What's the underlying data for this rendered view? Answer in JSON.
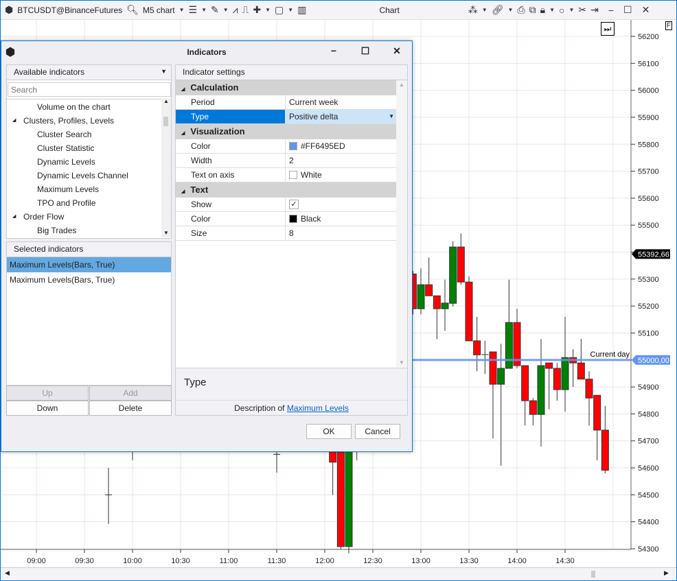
{
  "toolbar": {
    "symbol": "BTCUSDT@BinanceFutures",
    "timeframe": "M5 chart",
    "title": "Chart"
  },
  "dialog": {
    "title": "Indicators",
    "available_label": "Available indicators",
    "search_placeholder": "Search",
    "tree": [
      {
        "label": "Volume on the chart",
        "level": 2
      },
      {
        "label": "Clusters, Profiles, Levels",
        "level": 1
      },
      {
        "label": "Cluster Search",
        "level": 2
      },
      {
        "label": "Cluster Statistic",
        "level": 2
      },
      {
        "label": "Dynamic Levels",
        "level": 2
      },
      {
        "label": "Dynamic Levels Channel",
        "level": 2
      },
      {
        "label": "Maximum Levels",
        "level": 2
      },
      {
        "label": "TPO and Profile",
        "level": 2
      },
      {
        "label": "Order Flow",
        "level": 1
      },
      {
        "label": "Big Trades",
        "level": 2
      }
    ],
    "selected_label": "Selected indicators",
    "selected": [
      "Maximum Levels(Bars, True)",
      "Maximum Levels(Bars, True)"
    ],
    "buttons": {
      "up": "Up",
      "add": "Add",
      "down": "Down",
      "delete": "Delete",
      "ok": "OK",
      "cancel": "Cancel"
    },
    "settings_label": "Indicator settings",
    "groups": [
      {
        "name": "Calculation",
        "rows": [
          {
            "k": "Period",
            "v": "Current week"
          },
          {
            "k": "Type",
            "v": "Positive delta"
          }
        ]
      },
      {
        "name": "Visualization",
        "rows": [
          {
            "k": "Color",
            "v": "#FF6495ED",
            "swatch": "#6495ED"
          },
          {
            "k": "Width",
            "v": "2"
          },
          {
            "k": "Text on axis",
            "v": "White",
            "swatch": "#ffffff"
          }
        ]
      },
      {
        "name": "Text",
        "rows": [
          {
            "k": "Show",
            "v": "✓"
          },
          {
            "k": "Color",
            "v": "Black",
            "swatch": "#000000"
          },
          {
            "k": "Size",
            "v": "8"
          }
        ]
      }
    ],
    "desc_title": "Type",
    "desc_prefix": "Description of",
    "desc_link": "Maximum Levels"
  },
  "chart_data": {
    "type": "candlestick",
    "ylim": [
      54300,
      56200
    ],
    "y_ticks": [
      56200,
      56100,
      56000,
      55900,
      55800,
      55700,
      55600,
      55500,
      55400,
      55300,
      55200,
      55100,
      55000,
      54900,
      54800,
      54700,
      54600,
      54500,
      54400,
      54300
    ],
    "x_ticks": [
      "09:00",
      "09:30",
      "10:00",
      "10:30",
      "11:00",
      "11:30",
      "12:00",
      "12:30",
      "13:00",
      "13:30",
      "14:00",
      "14:30"
    ],
    "last_price": "55392,66",
    "level_price": "55000,00",
    "level_label": "Current day",
    "level_value": 55000,
    "up_color": "#008000",
    "down_color": "#ff0000",
    "level_color": "#6495ED",
    "candles": [
      {
        "t": "09:45",
        "o": 54500,
        "h": 54600,
        "l": 54392,
        "c": 54500
      },
      {
        "t": "10:00",
        "o": 54700,
        "h": 54750,
        "l": 54628,
        "c": 54700
      },
      {
        "t": "11:30",
        "o": 54650,
        "h": 54700,
        "l": 54582,
        "c": 54650
      },
      {
        "t": "12:05",
        "o": 54750,
        "h": 54800,
        "l": 54499,
        "c": 54621
      },
      {
        "t": "12:10",
        "o": 54659,
        "h": 54670,
        "l": 54298,
        "c": 54308
      },
      {
        "t": "12:15",
        "o": 54308,
        "h": 54950,
        "l": 54283,
        "c": 54900
      },
      {
        "t": "12:20",
        "o": 54800,
        "h": 54850,
        "l": 54628,
        "c": 54800
      },
      {
        "t": "12:55",
        "o": 55319,
        "h": 55330,
        "l": 55169,
        "c": 55190
      },
      {
        "t": "13:00",
        "o": 55190,
        "h": 55340,
        "l": 55169,
        "c": 55279
      },
      {
        "t": "13:05",
        "o": 55279,
        "h": 55380,
        "l": 55238,
        "c": 55238
      },
      {
        "t": "13:10",
        "o": 55238,
        "h": 55238,
        "l": 55077,
        "c": 55190
      },
      {
        "t": "13:15",
        "o": 55190,
        "h": 55298,
        "l": 55108,
        "c": 55211
      },
      {
        "t": "13:20",
        "o": 55210,
        "h": 55440,
        "l": 55198,
        "c": 55419
      },
      {
        "t": "13:25",
        "o": 55419,
        "h": 55469,
        "l": 55279,
        "c": 55289
      },
      {
        "t": "13:30",
        "o": 55289,
        "h": 55310,
        "l": 55071,
        "c": 55071
      },
      {
        "t": "13:35",
        "o": 55071,
        "h": 55160,
        "l": 54958,
        "c": 55019
      },
      {
        "t": "13:40",
        "o": 55020,
        "h": 55071,
        "l": 54948,
        "c": 55020
      },
      {
        "t": "13:45",
        "o": 55030,
        "h": 55030,
        "l": 54709,
        "c": 54910
      },
      {
        "t": "13:50",
        "o": 54910,
        "h": 55060,
        "l": 54608,
        "c": 54969
      },
      {
        "t": "13:55",
        "o": 54969,
        "h": 55298,
        "l": 54969,
        "c": 55139
      },
      {
        "t": "14:00",
        "o": 55139,
        "h": 55190,
        "l": 54969,
        "c": 54979
      },
      {
        "t": "14:05",
        "o": 54979,
        "h": 54979,
        "l": 54757,
        "c": 54849
      },
      {
        "t": "14:10",
        "o": 54849,
        "h": 54859,
        "l": 54757,
        "c": 54798
      },
      {
        "t": "14:15",
        "o": 54798,
        "h": 55078,
        "l": 54679,
        "c": 54979
      },
      {
        "t": "14:20",
        "o": 54989,
        "h": 54989,
        "l": 54817,
        "c": 54969
      },
      {
        "t": "14:25",
        "o": 54969,
        "h": 54989,
        "l": 54849,
        "c": 54890
      },
      {
        "t": "14:30",
        "o": 54890,
        "h": 55160,
        "l": 54808,
        "c": 55009
      },
      {
        "t": "14:35",
        "o": 55009,
        "h": 55040,
        "l": 54900,
        "c": 54989
      },
      {
        "t": "14:40",
        "o": 54989,
        "h": 55078,
        "l": 54929,
        "c": 54929
      },
      {
        "t": "14:45",
        "o": 54929,
        "h": 54958,
        "l": 54757,
        "c": 54859
      },
      {
        "t": "14:50",
        "o": 54869,
        "h": 54869,
        "l": 54628,
        "c": 54740
      },
      {
        "t": "14:55",
        "o": 54740,
        "h": 54830,
        "l": 54580,
        "c": 54591
      }
    ]
  }
}
